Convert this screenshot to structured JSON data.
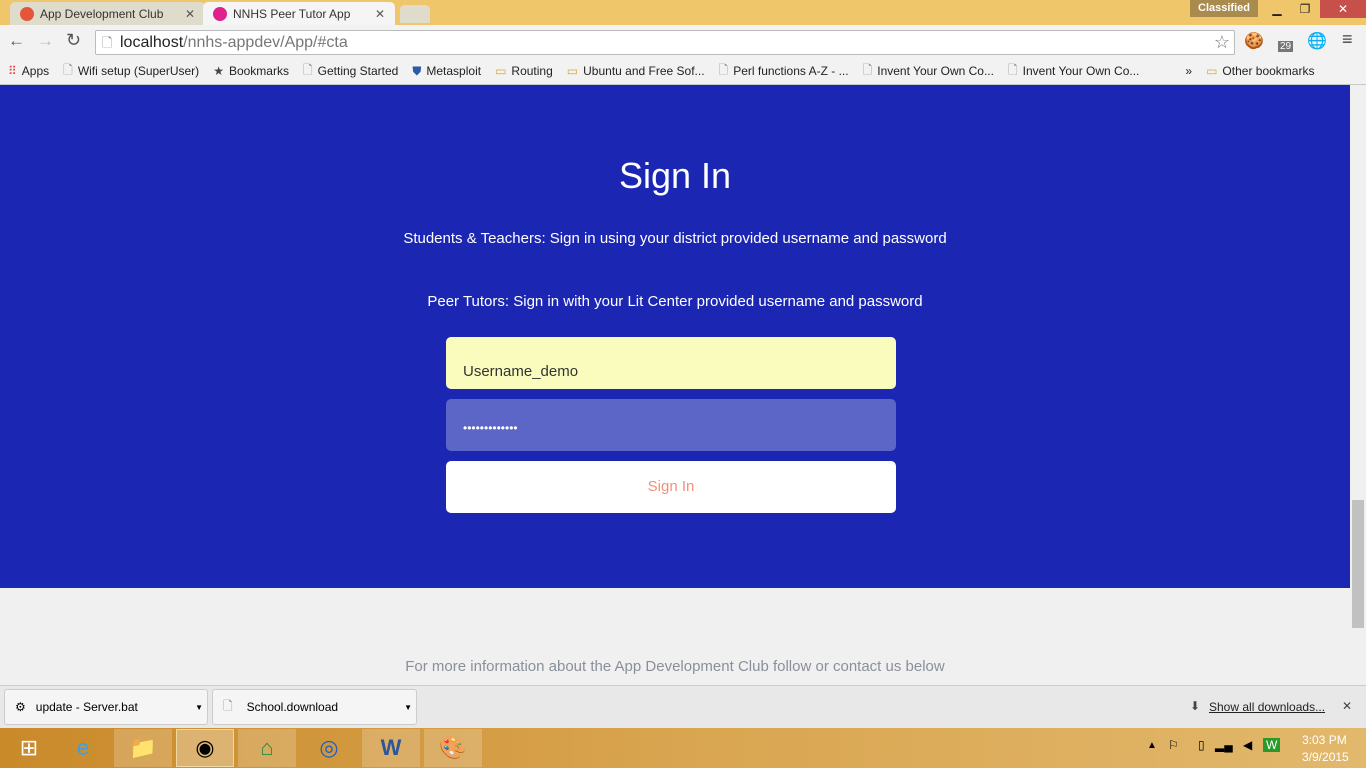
{
  "browser": {
    "tabs": [
      {
        "title": "App Development Club",
        "active": false
      },
      {
        "title": "NNHS Peer Tutor App",
        "active": true
      }
    ],
    "badge": "Classified",
    "url_host": "localhost",
    "url_path": "/nnhs-appdev/App/#cta",
    "ext_badge": "29",
    "bookmarks": [
      "Apps",
      "Wifi setup (SuperUser)",
      "Bookmarks",
      "Getting Started",
      "Metasploit",
      "Routing",
      "Ubuntu and Free Sof...",
      "Perl functions A-Z - ...",
      "Invent Your Own Co...",
      "Invent Your Own Co..."
    ],
    "bookmarks_overflow": "»",
    "other_bookmarks": "Other bookmarks"
  },
  "page": {
    "title": "Sign In",
    "line1": "Students & Teachers: Sign in using your district provided username and password",
    "line2": "Peer Tutors: Sign in with your Lit Center provided username and password",
    "username": "Username_demo",
    "password": "•••••••••••••",
    "signin": "Sign In",
    "footer": "For more information about the App Development Club follow or contact us below"
  },
  "downloads": {
    "items": [
      "update - Server.bat",
      "School.download"
    ],
    "show_all": "Show all downloads..."
  },
  "taskbar": {
    "time": "3:03 PM",
    "date": "3/9/2015"
  }
}
